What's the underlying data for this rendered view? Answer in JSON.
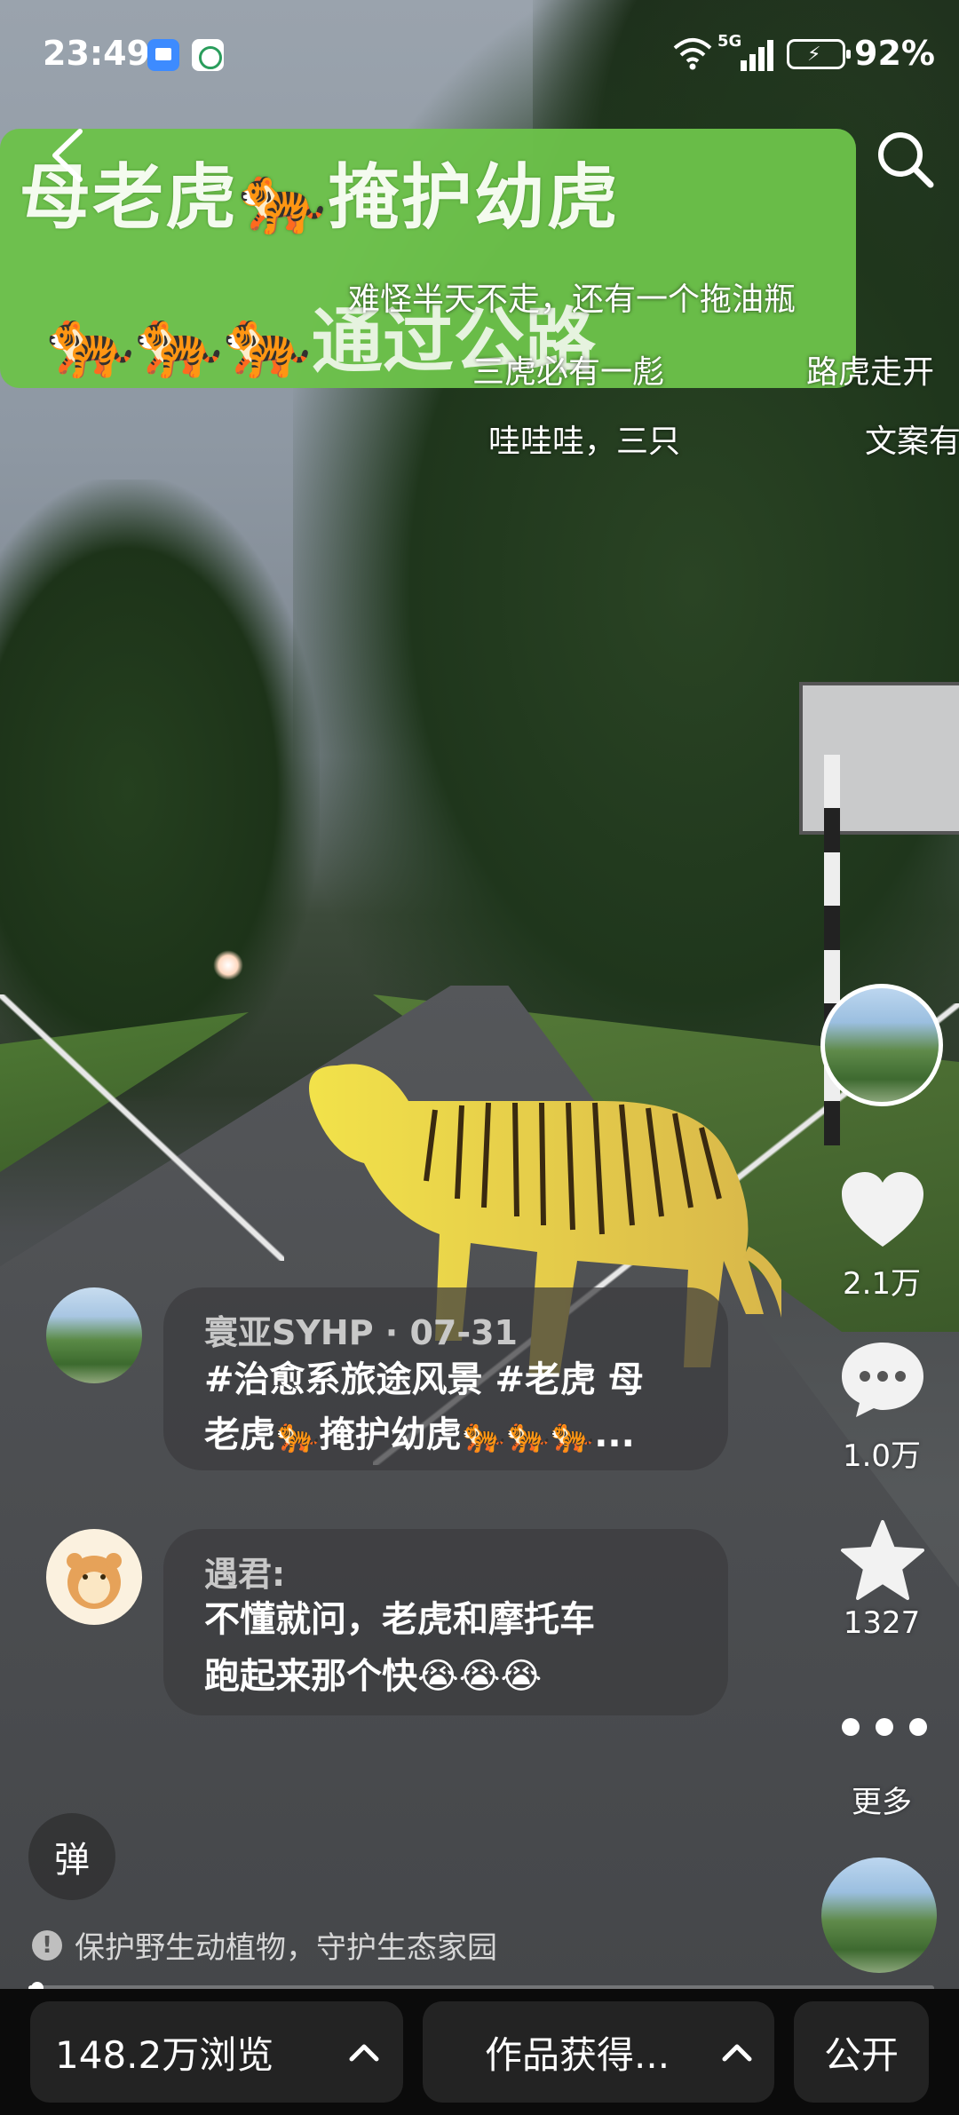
{
  "status_bar": {
    "time": "23:49",
    "network": "5G",
    "battery": "92%"
  },
  "title_banner": {
    "line1": "母老虎🐅掩护幼虎",
    "line2": "🐅🐅🐅通过公路"
  },
  "danmaku": [
    "难怪半天不走，还有一个拖油瓶",
    "三虎必有一彪",
    "路虎走开",
    "哇哇哇，三只",
    "文案有"
  ],
  "actions": {
    "like_count": "2.1万",
    "comment_count": "1.0万",
    "favorite_count": "1327",
    "more_label": "更多"
  },
  "comments": [
    {
      "author": "寰亚SYHP",
      "date": "07-31",
      "lines": [
        "#治愈系旅途风景 #老虎 母",
        "老虎🐅掩护幼虎🐅🐅🐅..."
      ]
    },
    {
      "author": "遇君:",
      "lines": [
        "不懂就问，老虎和摩托车",
        "跑起来那个快😭😭😭"
      ]
    }
  ],
  "danmaku_button": "弹",
  "notice": "保护野生动植物，守护生态家园",
  "progress": 0.01,
  "bottom": {
    "views": "148.2万浏览",
    "works": "作品获得...",
    "visibility": "公开"
  },
  "colors": {
    "banner_green": "#6cc24a",
    "bubble_bg": "#3c3c3e",
    "bottom_bar": "#0b0b0b"
  }
}
